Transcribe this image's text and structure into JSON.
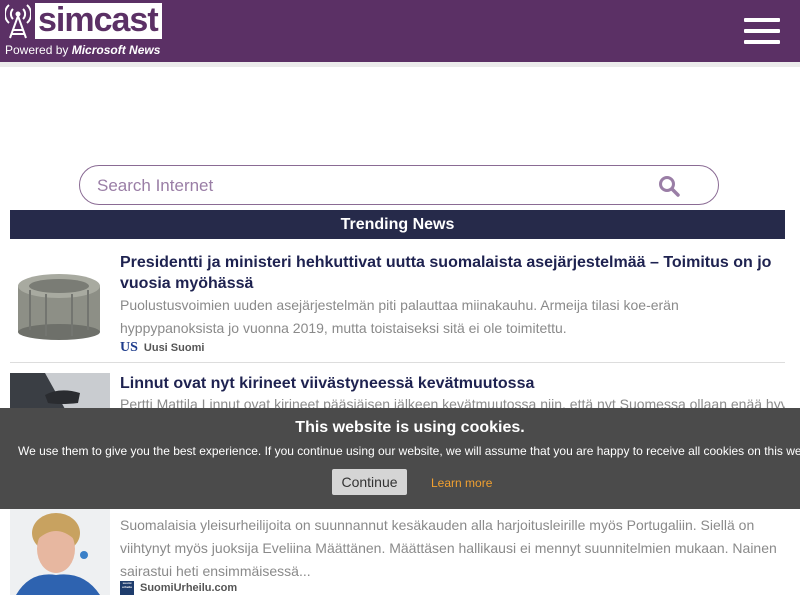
{
  "header": {
    "brand": "simcast",
    "powered_prefix": "Powered by",
    "powered_brand": "Microsoft News"
  },
  "search": {
    "placeholder": "Search Internet"
  },
  "trending": {
    "heading": "Trending News"
  },
  "articles": [
    {
      "title": "Presidentti ja ministeri hehkuttivat uutta suomalaista asejärjestelmää – Toimitus on jo vuosia myöhässä",
      "description": "Puolustusvoimien uuden asejärjestelmän piti palauttaa miinakauhu. Armeija tilasi koe-erän hyppypanoksista jo vuonna 2019, mutta toistaiseksi sitä ei ole toimitettu.",
      "source": "Uusi Suomi",
      "source_badge": "US"
    },
    {
      "title": "Linnut ovat nyt kirineet viivästyneessä kevätmuutossa",
      "description": "Pertti Mattila Linnut ovat kirineet pääsiäisen jälkeen kevätmuutossa niin, että nyt Suomessa ollaan enää hyvin"
    },
    {
      "description": "Suomalaisia yleisurheilijoita on suunnannut kesäkauden alla harjoitusleirille myös Portugaliin. Siellä on viihtynyt myös juoksija Eveliina Määttänen. Määttäsen hallikausi ei mennyt suunnitelmien mukaan. Nainen sairastui heti ensimmäisessä...",
      "source": "SuomiUrheilu.com",
      "source_badge": "suomi urheilu"
    }
  ],
  "cookie": {
    "title": "This website is using cookies.",
    "text": "We use them to give you the best experience. If you continue using our website, we will assume that you are happy to receive all cookies on this website.",
    "button": "Continue",
    "link": "Learn more"
  },
  "colors": {
    "header": "#5b3065",
    "trending_bar": "#262a4a",
    "title_text": "#1e2250",
    "cookie_bar": "#4b4b4b",
    "cookie_link": "#f0a030"
  }
}
